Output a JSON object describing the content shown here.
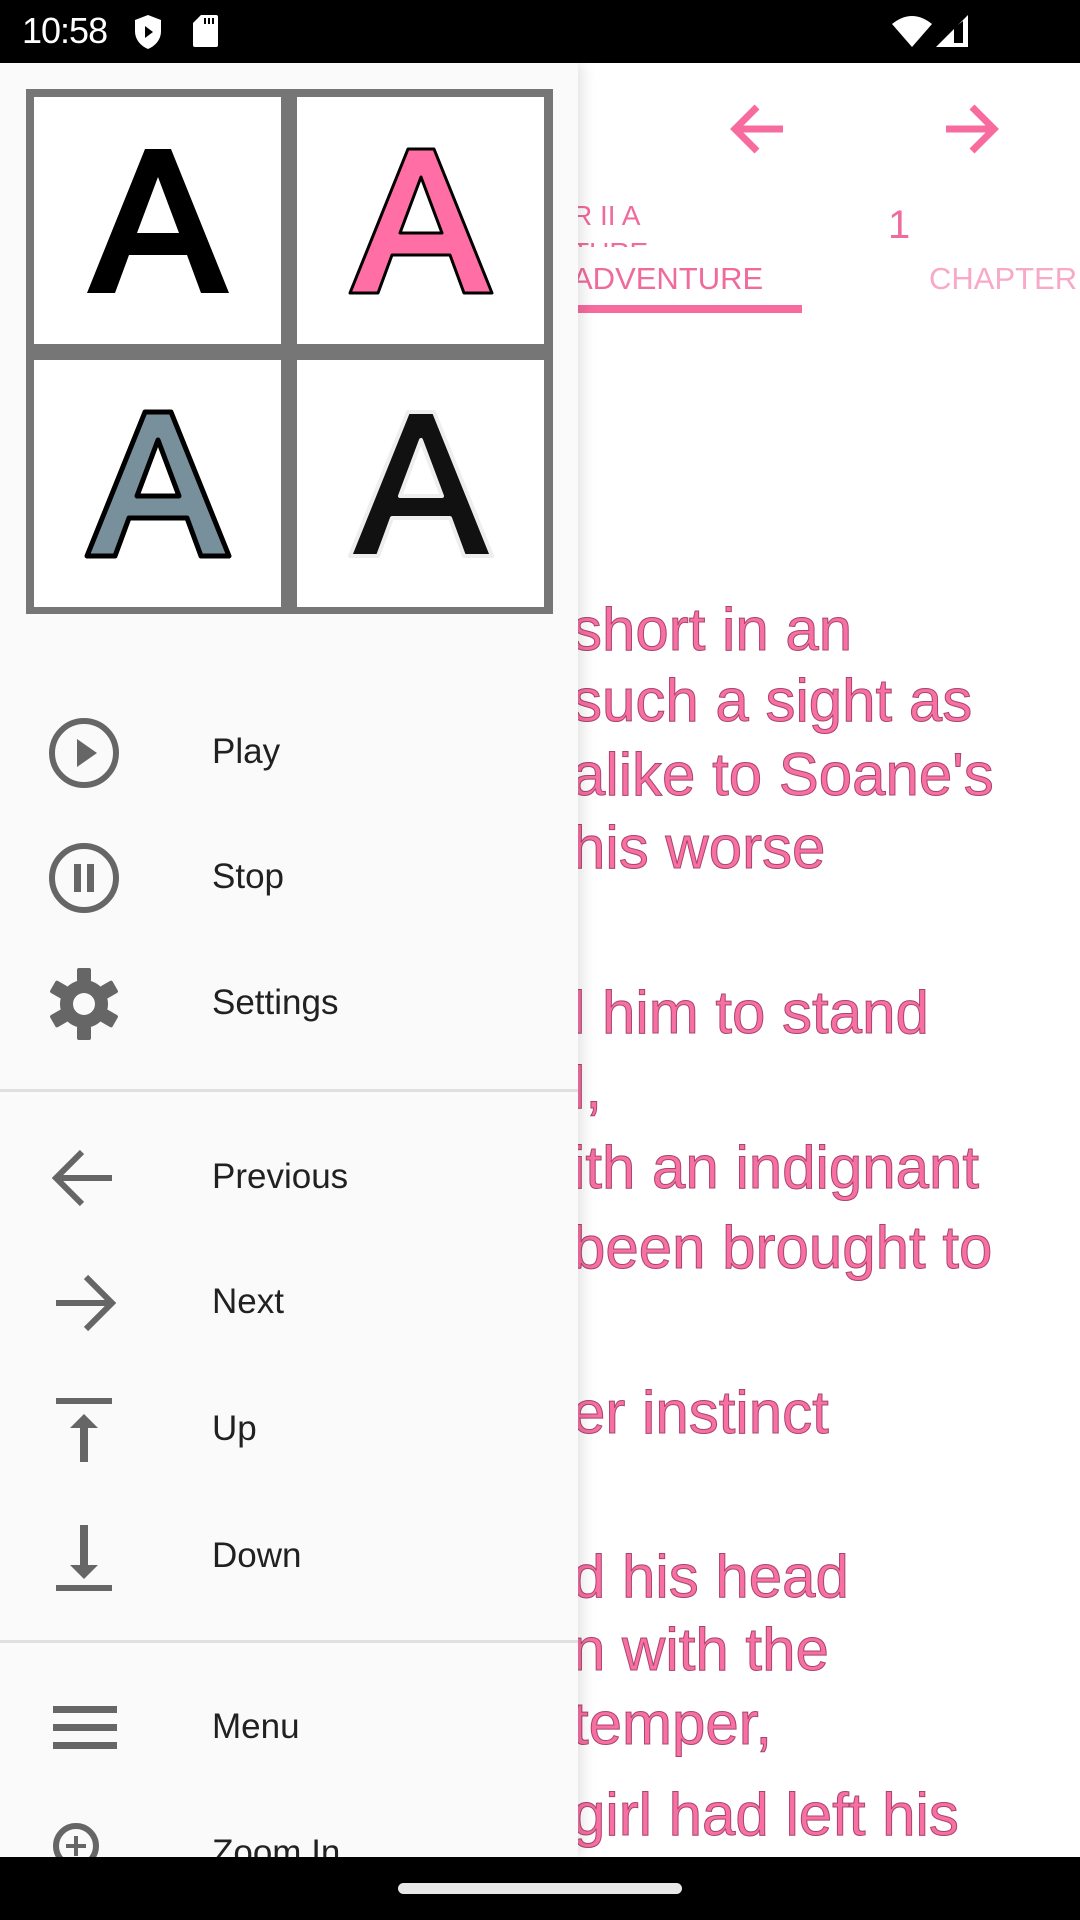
{
  "status_bar": {
    "time": "10:58",
    "left_icons": [
      "shield-play-icon",
      "sd-card-icon"
    ],
    "right_icons": [
      "wifi-icon",
      "cell-signal-icon"
    ]
  },
  "reader": {
    "prev_icon": "arrow-left-icon",
    "next_icon": "arrow-right-icon",
    "title_fragment": "R II A",
    "title_fragment_2": "TURE",
    "page_number": "1",
    "tabs": [
      {
        "label": "ADVENTURE",
        "selected": true
      },
      {
        "label": "CHAPTER",
        "selected": false
      }
    ],
    "accent_color": "#F06A9B",
    "lines": [
      "short in an",
      "such a sight as",
      "alike to Soane's",
      "his worse",
      "l him to stand",
      "l,",
      "ith an indignant",
      "been brought to",
      "er instinct",
      "d his head",
      "n with the",
      "temper,",
      "girl had left his"
    ]
  },
  "drawer": {
    "text_styles": [
      {
        "name": "plain-black",
        "glyph": "A",
        "fill": "#000000"
      },
      {
        "name": "pink-outlined",
        "glyph": "A",
        "fill": "#FF6FA5"
      },
      {
        "name": "gray-outlined",
        "glyph": "A",
        "fill": "#78909C"
      },
      {
        "name": "black-halo",
        "glyph": "A",
        "fill": "#111111"
      }
    ],
    "groups": [
      [
        {
          "label": "Play",
          "icon": "play-circle-icon"
        },
        {
          "label": "Stop",
          "icon": "pause-circle-icon"
        },
        {
          "label": "Settings",
          "icon": "gear-icon"
        }
      ],
      [
        {
          "label": "Previous",
          "icon": "arrow-left-icon"
        },
        {
          "label": "Next",
          "icon": "arrow-right-icon"
        },
        {
          "label": "Up",
          "icon": "arrow-up-to-top-icon"
        },
        {
          "label": "Down",
          "icon": "arrow-down-to-bottom-icon"
        }
      ],
      [
        {
          "label": "Menu",
          "icon": "menu-icon"
        },
        {
          "label": "Zoom In",
          "icon": "zoom-in-icon"
        }
      ]
    ]
  }
}
